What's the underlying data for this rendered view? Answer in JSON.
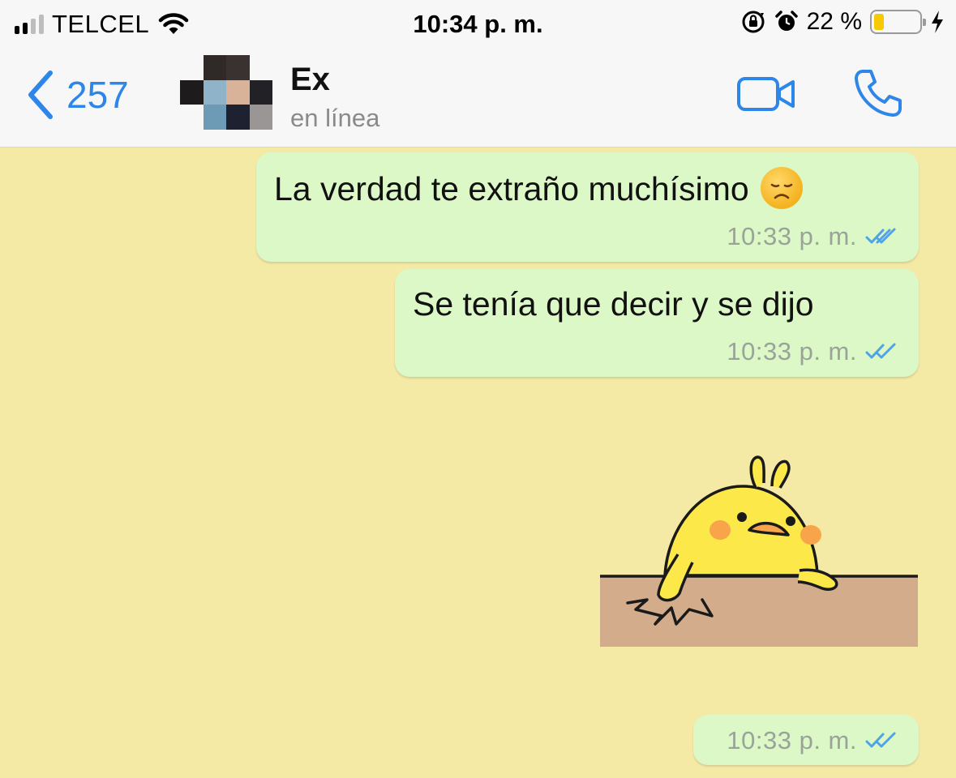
{
  "status_bar": {
    "carrier": "TELCEL",
    "time": "10:34 p. m.",
    "battery_percent": "22 %",
    "battery_level": 0.22,
    "signal_bars": 4,
    "signal_active": 2,
    "icons": [
      "wifi-icon",
      "orientation-lock-icon",
      "alarm-icon",
      "battery-icon",
      "charging-icon"
    ]
  },
  "nav": {
    "back_count": "257",
    "contact_name": "Ex",
    "contact_status": "en línea",
    "icons": [
      "back-chevron-icon",
      "video-call-icon",
      "phone-call-icon"
    ]
  },
  "messages": [
    {
      "type": "text",
      "text": "La verdad te extraño muchísimo",
      "emoji": "disappointed-face-emoji",
      "time": "10:33 p. m.",
      "status": "read"
    },
    {
      "type": "text",
      "text": "Se tenía que decir y se dijo",
      "time": "10:33 p. m.",
      "status": "read"
    },
    {
      "type": "sticker",
      "sticker": "yellow-chick-breaking-table-sticker"
    },
    {
      "type": "timestamp-only",
      "time": "10:33 p. m.",
      "status": "read"
    }
  ],
  "colors": {
    "accent": "#2e86e8",
    "bubble_outgoing": "#dcf8c6",
    "chat_background": "#f5e9a6",
    "read_ticks": "#4fa3e6"
  }
}
